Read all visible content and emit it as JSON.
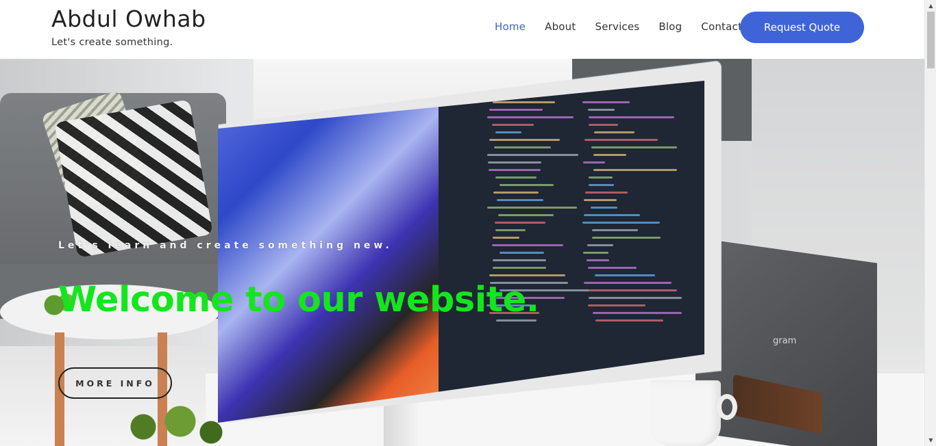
{
  "header": {
    "brand_name": "Abdul Owhab",
    "brand_tagline": "Let's create something.",
    "nav": [
      {
        "label": "Home",
        "active": true
      },
      {
        "label": "About",
        "active": false
      },
      {
        "label": "Services",
        "active": false
      },
      {
        "label": "Blog",
        "active": false
      },
      {
        "label": "Contact",
        "active": false
      }
    ],
    "cta_label": "Request Quote"
  },
  "hero": {
    "subtitle": "Let's learn and create something new.",
    "title": "Welcome to our website.",
    "button_label": "MORE INFO",
    "laptop_brand": "gram"
  },
  "colors": {
    "accent": "#3f64d8",
    "nav_active": "#3f5fd6",
    "hero_title": "#13e61d"
  }
}
